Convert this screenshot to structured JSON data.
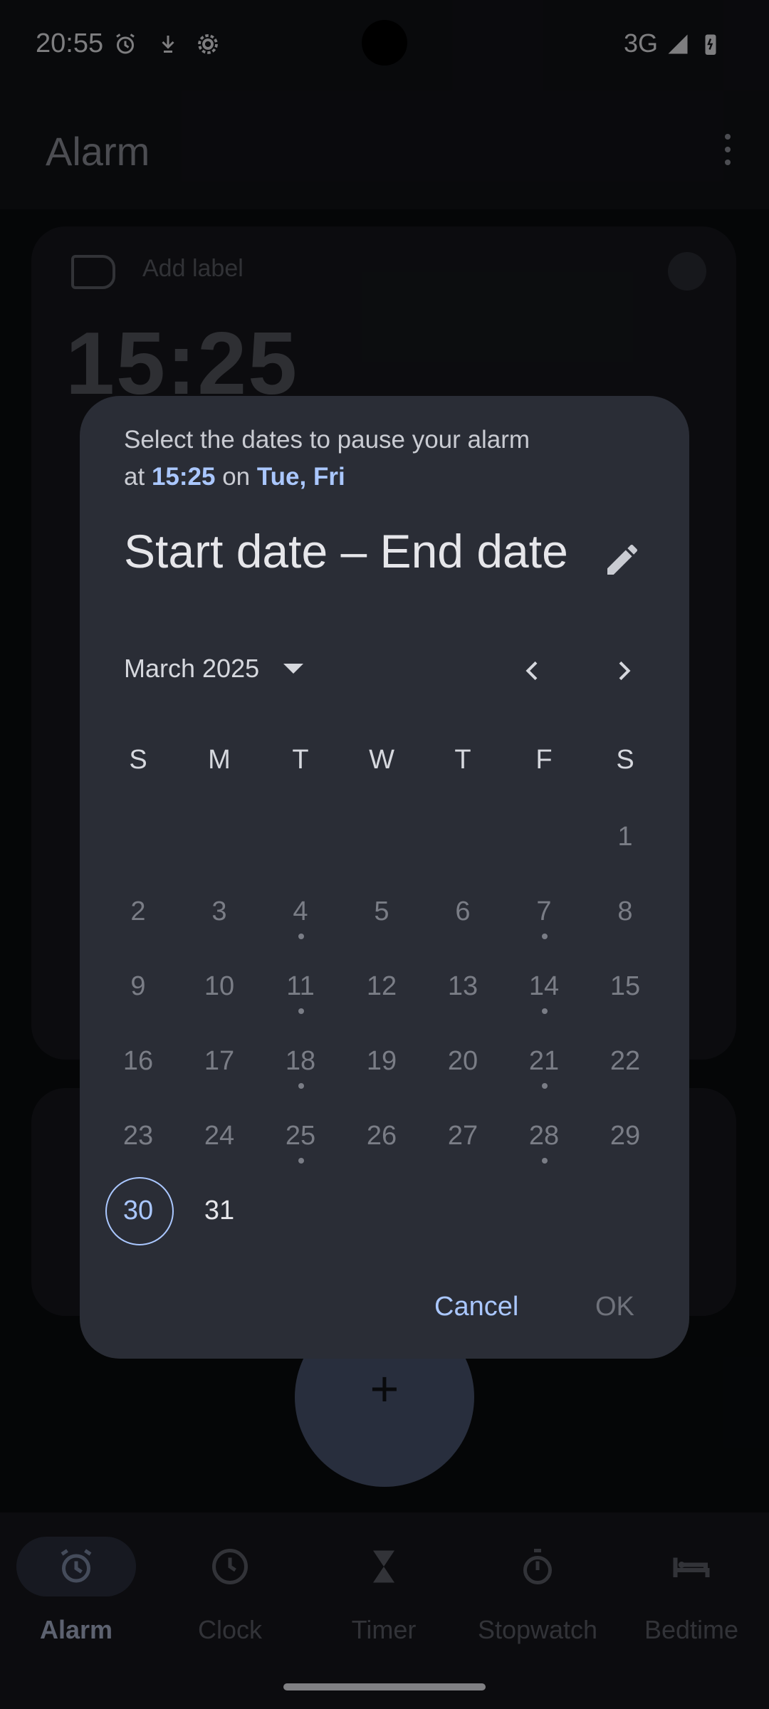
{
  "status_bar": {
    "time": "20:55",
    "network": "3G"
  },
  "app_bar": {
    "title": "Alarm"
  },
  "background": {
    "add_label": "Add label",
    "alarm_time": "15:25"
  },
  "dialog": {
    "prompt_prefix": "Select the dates to pause your alarm",
    "prompt_at": "at",
    "prompt_time": "15:25",
    "prompt_on": "on",
    "prompt_days": "Tue, Fri",
    "range_title": "Start date – End date",
    "month_label": "March 2025",
    "weekdays": [
      "S",
      "M",
      "T",
      "W",
      "T",
      "F",
      "S"
    ],
    "days": [
      "1",
      "2",
      "3",
      "4",
      "5",
      "6",
      "7",
      "8",
      "9",
      "10",
      "11",
      "12",
      "13",
      "14",
      "15",
      "16",
      "17",
      "18",
      "19",
      "20",
      "21",
      "22",
      "23",
      "24",
      "25",
      "26",
      "27",
      "28",
      "29",
      "30",
      "31"
    ],
    "cancel_label": "Cancel",
    "ok_label": "OK"
  },
  "bottom_nav": {
    "items": [
      {
        "label": "Alarm"
      },
      {
        "label": "Clock"
      },
      {
        "label": "Timer"
      },
      {
        "label": "Stopwatch"
      },
      {
        "label": "Bedtime"
      }
    ]
  },
  "colors": {
    "accent": "#aac7ff",
    "dialog_bg": "#2a2d36"
  }
}
